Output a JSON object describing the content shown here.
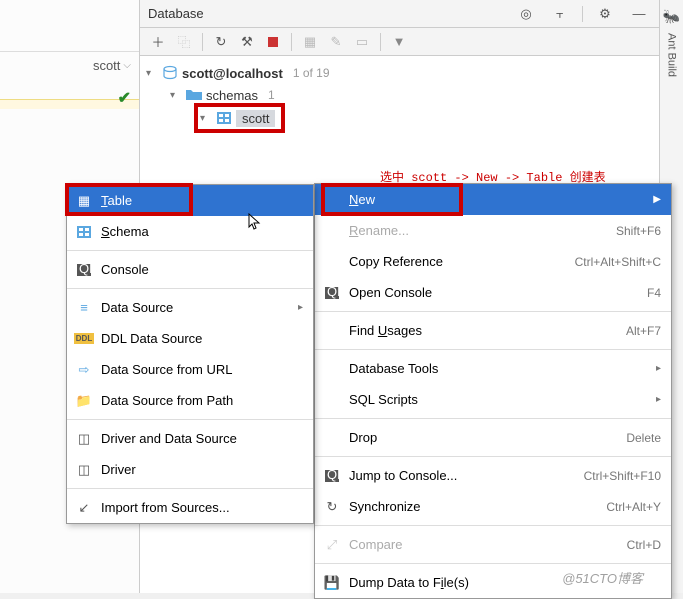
{
  "left_panel": {
    "label": "scott"
  },
  "header": {
    "title": "Database"
  },
  "tree": {
    "root": {
      "label": "scott@localhost",
      "count": "1 of 19"
    },
    "schemas": {
      "label": "schemas",
      "count": "1"
    },
    "scott": {
      "label": "scott"
    }
  },
  "annotation": "选中 scott -> New -> Table 创建表",
  "menu1": {
    "table": "Table",
    "schema": "Schema",
    "console": "Console",
    "data_source": "Data Source",
    "ddl_data_source": "DDL Data Source",
    "data_source_url": "Data Source from URL",
    "data_source_path": "Data Source from Path",
    "driver_and_ds": "Driver and Data Source",
    "driver": "Driver",
    "import": "Import from Sources..."
  },
  "menu2": {
    "new": "New",
    "rename": "Rename...",
    "rename_sc": "Shift+F6",
    "copy_ref": "Copy Reference",
    "copy_ref_sc": "Ctrl+Alt+Shift+C",
    "open_console": "Open Console",
    "open_console_sc": "F4",
    "find_usages": "Find Usages",
    "find_usages_sc": "Alt+F7",
    "db_tools": "Database Tools",
    "sql_scripts": "SQL Scripts",
    "drop": "Drop",
    "drop_sc": "Delete",
    "jump_console": "Jump to Console...",
    "jump_console_sc": "Ctrl+Shift+F10",
    "synchronize": "Synchronize",
    "synchronize_sc": "Ctrl+Alt+Y",
    "compare": "Compare",
    "compare_sc": "Ctrl+D",
    "dump_data": "Dump Data to File(s)"
  },
  "sidebar": {
    "ant_build": "Ant Build"
  },
  "watermark": "@51CTO博客"
}
